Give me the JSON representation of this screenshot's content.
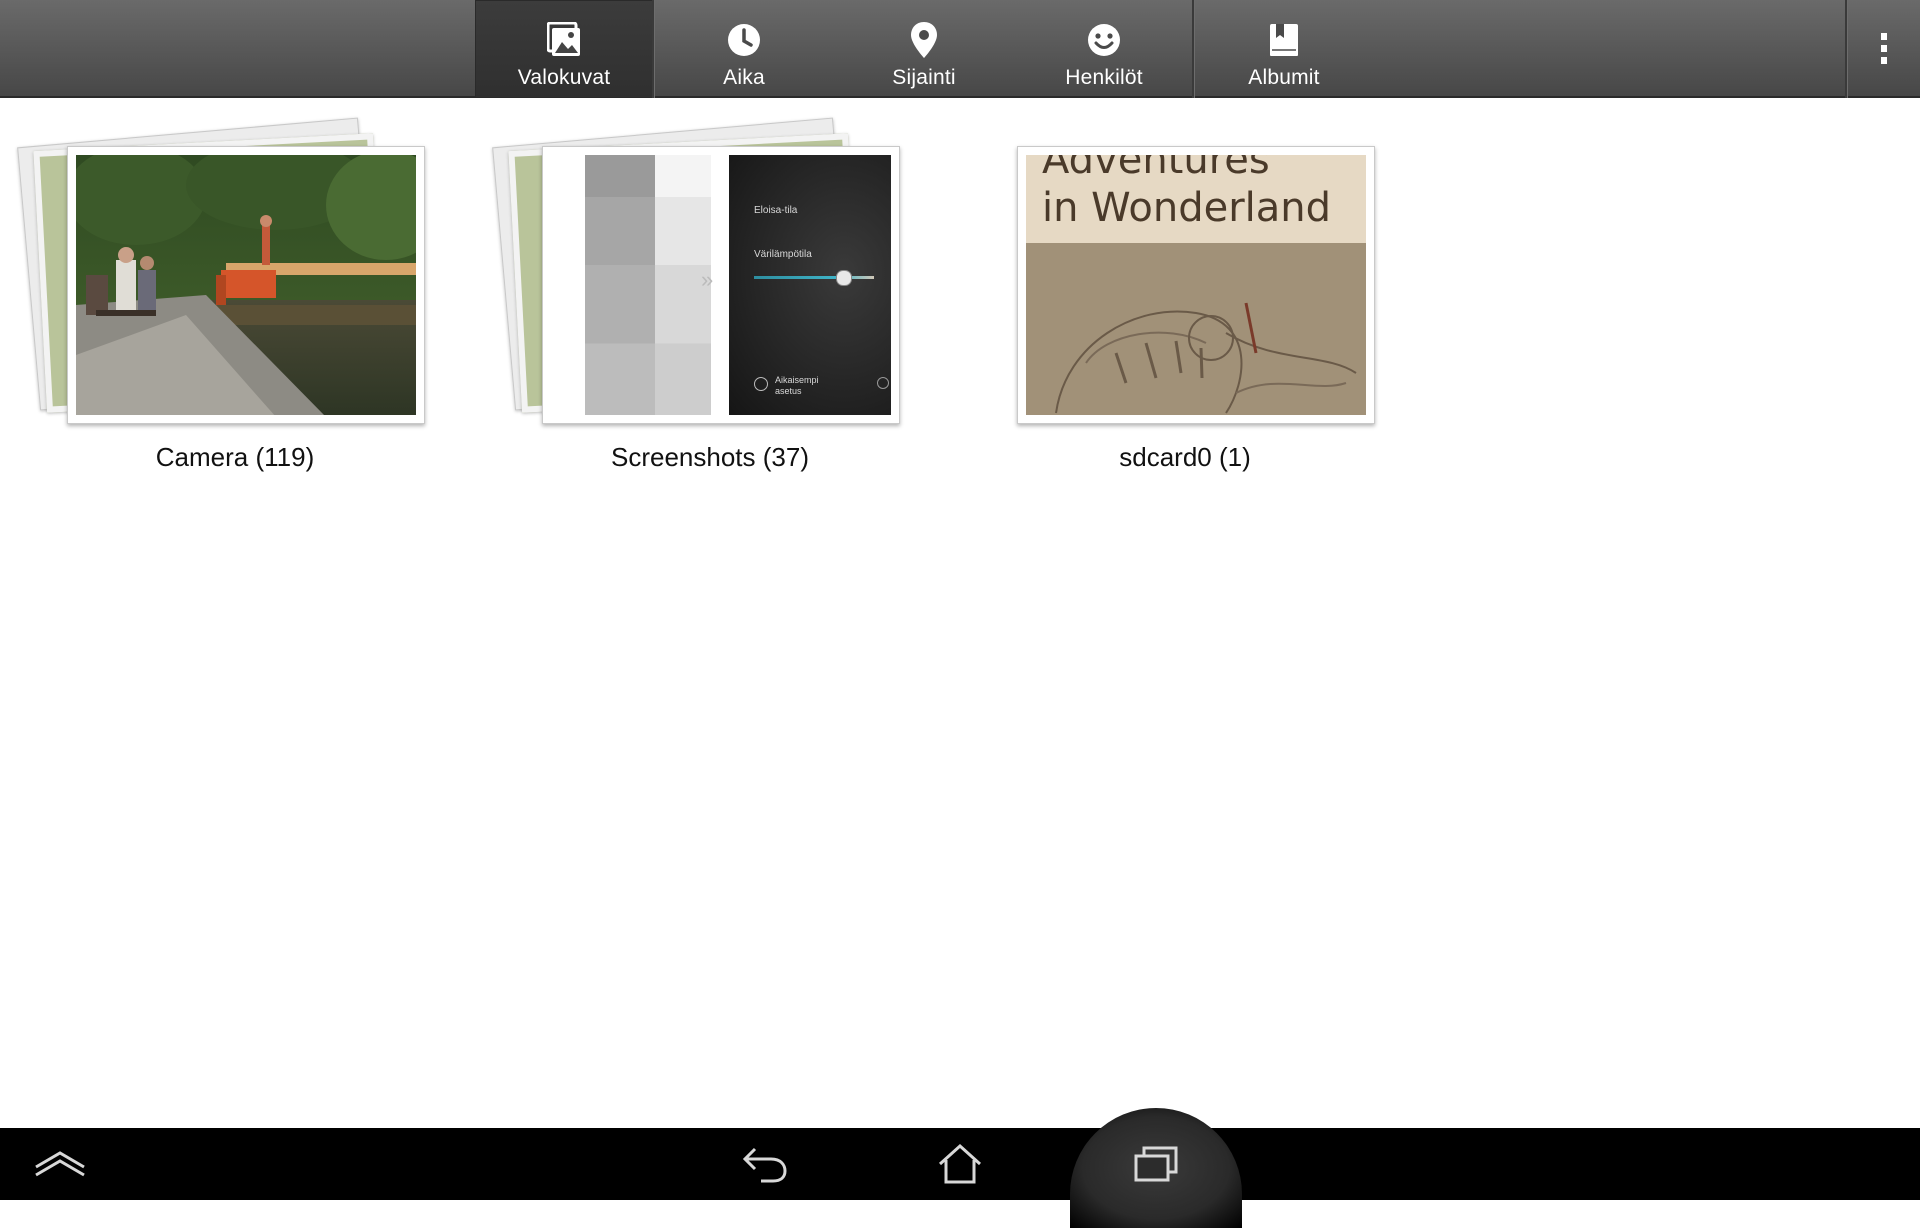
{
  "tabs": [
    {
      "label": "Valokuvat",
      "icon": "photos-icon",
      "selected": true
    },
    {
      "label": "Aika",
      "icon": "clock-icon",
      "selected": false
    },
    {
      "label": "Sijainti",
      "icon": "location-pin-icon",
      "selected": false
    },
    {
      "label": "Henkilöt",
      "icon": "smiley-face-icon",
      "selected": false
    },
    {
      "label": "Albumit",
      "icon": "album-book-icon",
      "selected": false
    }
  ],
  "albums": [
    {
      "label": "Camera (119)"
    },
    {
      "label": "Screenshots (37)",
      "thumb_text": {
        "line1": "Eloisa-tila",
        "line2": "Värilämpötila",
        "line3": "Aikaisempi asetus"
      }
    },
    {
      "label": "sdcard0 (1)",
      "thumb_text": {
        "line1": "Adventures",
        "line2": "in Wonderland"
      }
    }
  ],
  "colors": {
    "topbar": "#575757",
    "selected_tab": "#353535",
    "navbar": "#000000",
    "accent_slider": "#3fb4c8"
  }
}
